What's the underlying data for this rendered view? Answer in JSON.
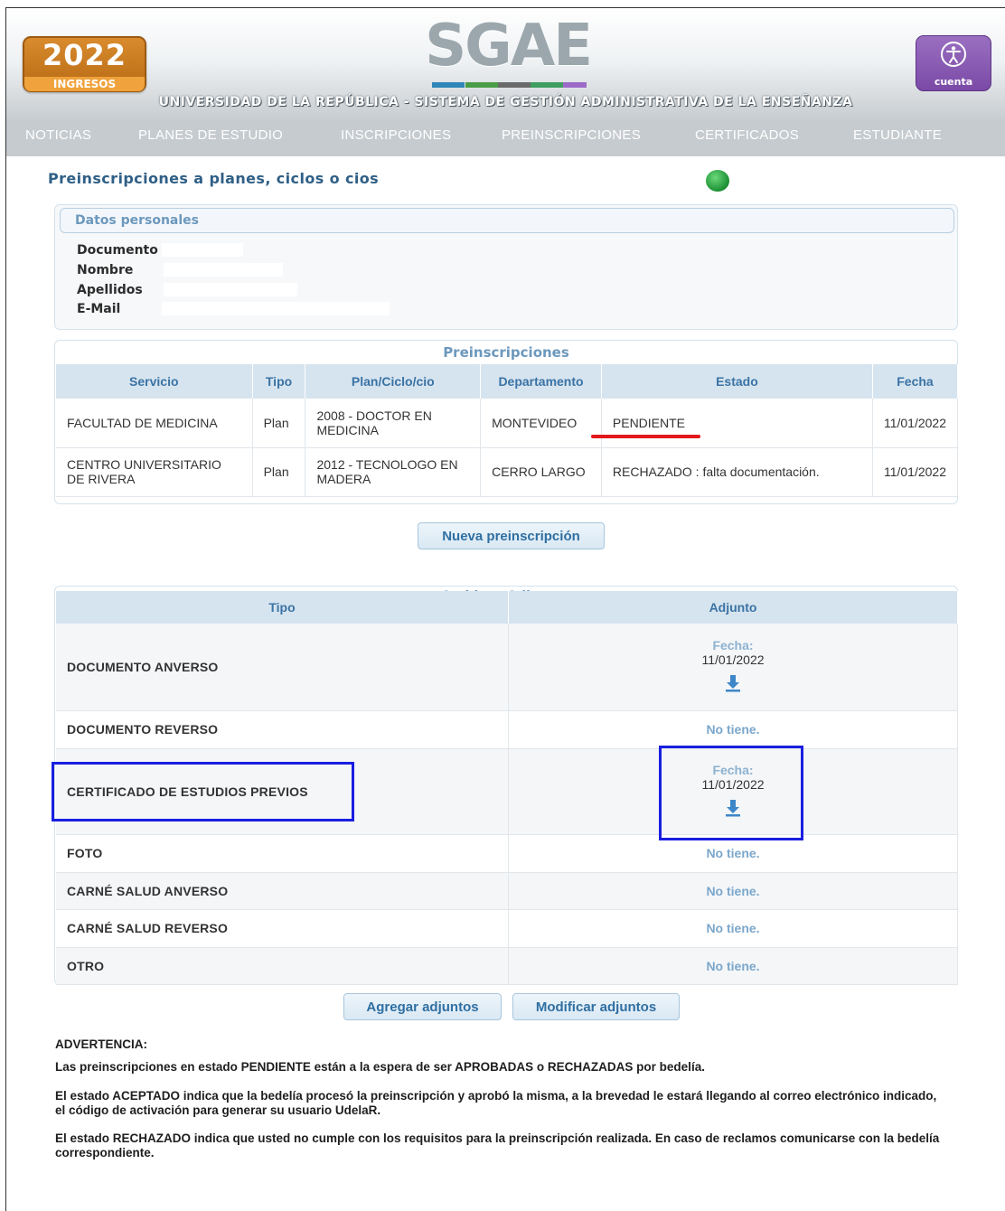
{
  "header": {
    "year": "2022",
    "year_sub": "INGRESOS",
    "logo": "SGAE",
    "tagline": "UNIVERSIDAD DE LA REPÚBLICA - SISTEMA DE GESTIÓN ADMINISTRATIVA DE LA ENSEÑANZA",
    "account_label": "cuenta",
    "account_icon": "accessibility-person-icon",
    "colors": {
      "badge": "#c97a20",
      "account": "#8a5cb6",
      "logo_bars": [
        "#2f86b8",
        "#4a9d48",
        "#6a6a6a",
        "#3e9e5f",
        "#9b6bc7"
      ]
    }
  },
  "nav": [
    "NOTICIAS",
    "PLANES DE ESTUDIO",
    "INSCRIPCIONES",
    "PREINSCRIPCIONES",
    "CERTIFICADOS",
    "ESTUDIANTE"
  ],
  "page_title": "Preinscripciones a planes, ciclos o cios",
  "status_indicator_color": "#2aa845",
  "personal": {
    "heading": "Datos personales",
    "labels": [
      "Documento",
      "Nombre",
      "Apellidos",
      "E-Mail"
    ]
  },
  "preinscripciones": {
    "caption": "Preinscripciones",
    "columns": [
      "Servicio",
      "Tipo",
      "Plan/Ciclo/cio",
      "Departamento",
      "Estado",
      "Fecha"
    ],
    "rows": [
      [
        "FACULTAD DE MEDICINA",
        "Plan",
        "2008 - DOCTOR EN MEDICINA",
        "MONTEVIDEO",
        "PENDIENTE",
        "11/01/2022"
      ],
      [
        "CENTRO UNIVERSITARIO DE RIVERA",
        "Plan",
        "2012 - TECNOLOGO EN MADERA",
        "CERRO LARGO",
        "RECHAZADO : falta documentación.",
        "11/01/2022"
      ]
    ]
  },
  "nueva_button": "Nueva preinscripción",
  "adjuntos": {
    "caption": "Archivos Adjuntos",
    "columns": [
      "Tipo",
      "Adjunto"
    ],
    "fecha_label": "Fecha:",
    "none_label": "No tiene.",
    "rows": [
      {
        "tipo": "DOCUMENTO ANVERSO",
        "fecha": "11/01/2022",
        "has_file": true
      },
      {
        "tipo": "DOCUMENTO REVERSO",
        "fecha": "",
        "has_file": false
      },
      {
        "tipo": "CERTIFICADO DE ESTUDIOS PREVIOS",
        "fecha": "11/01/2022",
        "has_file": true
      },
      {
        "tipo": "FOTO",
        "fecha": "",
        "has_file": false
      },
      {
        "tipo": "CARNÉ SALUD ANVERSO",
        "fecha": "",
        "has_file": false
      },
      {
        "tipo": "CARNÉ SALUD REVERSO",
        "fecha": "",
        "has_file": false
      },
      {
        "tipo": "OTRO",
        "fecha": "",
        "has_file": false
      }
    ]
  },
  "buttons": {
    "agregar": "Agregar adjuntos",
    "modificar": "Modificar adjuntos"
  },
  "advertencia": {
    "title": "ADVERTENCIA:",
    "paragraphs": [
      "Las preinscripciones en estado PENDIENTE están a la espera de ser APROBADAS o RECHAZADAS por bedelía.",
      "El estado ACEPTADO indica que la bedelía procesó la preinscripción y aprobó la misma, a la brevedad le estará llegando al correo electrónico indicado, el código de activación para generar su usuario UdelaR.",
      "El estado RECHAZADO indica que usted no cumple con los requisitos para la preinscripción realizada. En caso de reclamos comunicarse con la bedelía correspondiente."
    ]
  },
  "annotations": {
    "highlight_blue": "#1a1ee0",
    "underline_red": "#e11919"
  }
}
